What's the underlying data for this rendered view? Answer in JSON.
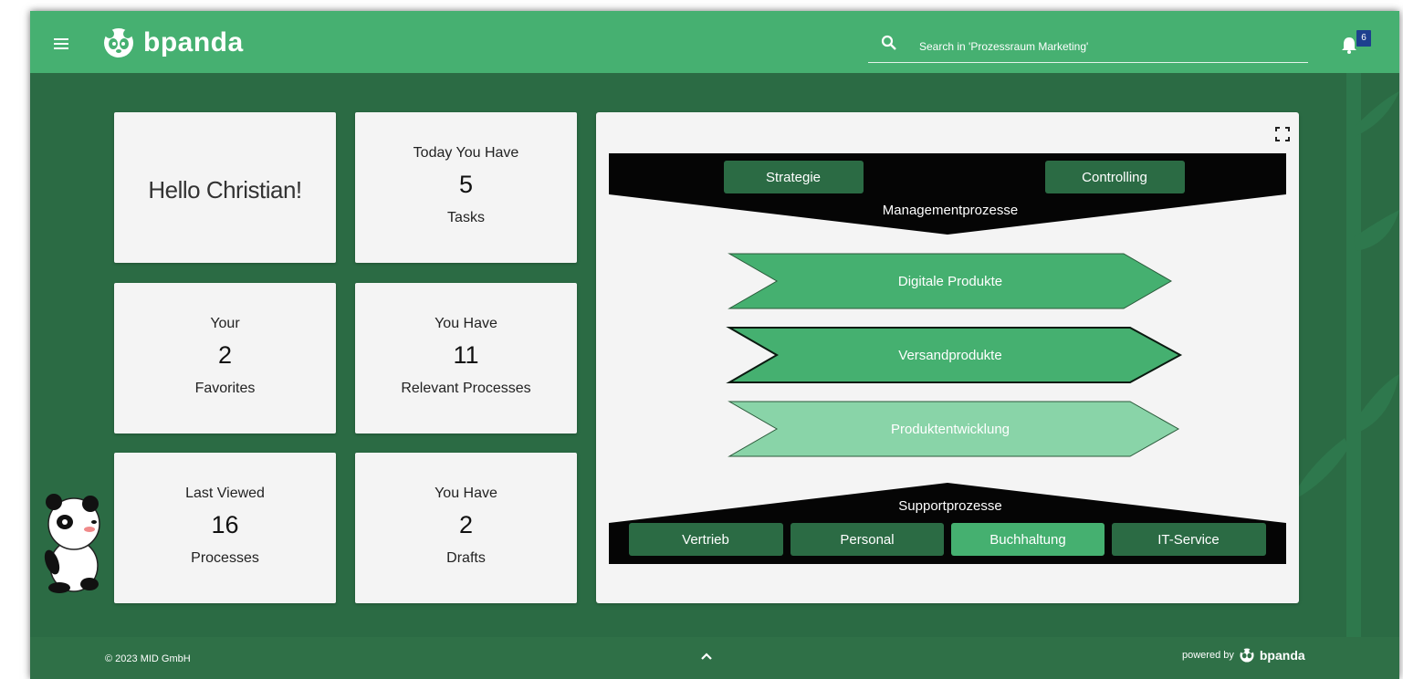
{
  "header": {
    "app_name": "bpanda",
    "search_placeholder": "Search in 'Prozessraum Marketing'",
    "notification_count": "6"
  },
  "cards": {
    "greeting": "Hello Christian!",
    "tasks": {
      "top": "Today You Have",
      "value": "5",
      "bottom": "Tasks"
    },
    "favorites": {
      "top": "Your",
      "value": "2",
      "bottom": "Favorites"
    },
    "relevant": {
      "top": "You Have",
      "value": "11",
      "bottom": "Relevant Processes"
    },
    "last_viewed": {
      "top": "Last Viewed",
      "value": "16",
      "bottom": "Processes"
    },
    "drafts": {
      "top": "You Have",
      "value": "2",
      "bottom": "Drafts"
    }
  },
  "process_map": {
    "management": {
      "label": "Managementprozesse",
      "items": [
        "Strategie",
        "Controlling"
      ]
    },
    "core": [
      "Digitale Produkte",
      "Versandprodukte",
      "Produktentwicklung"
    ],
    "support": {
      "label": "Supportprozesse",
      "items": [
        "Vertrieb",
        "Personal",
        "Buchhaltung",
        "IT-Service"
      ]
    }
  },
  "footer": {
    "copyright": "© 2023 MID GmbH",
    "powered_by": "powered by",
    "brand": "bpanda"
  },
  "colors": {
    "header_green": "#46b071",
    "background_green": "#2b6b44",
    "dark_button": "#2b6b44",
    "chevron_green": "#45b070",
    "chevron_light": "#89d4a8"
  }
}
